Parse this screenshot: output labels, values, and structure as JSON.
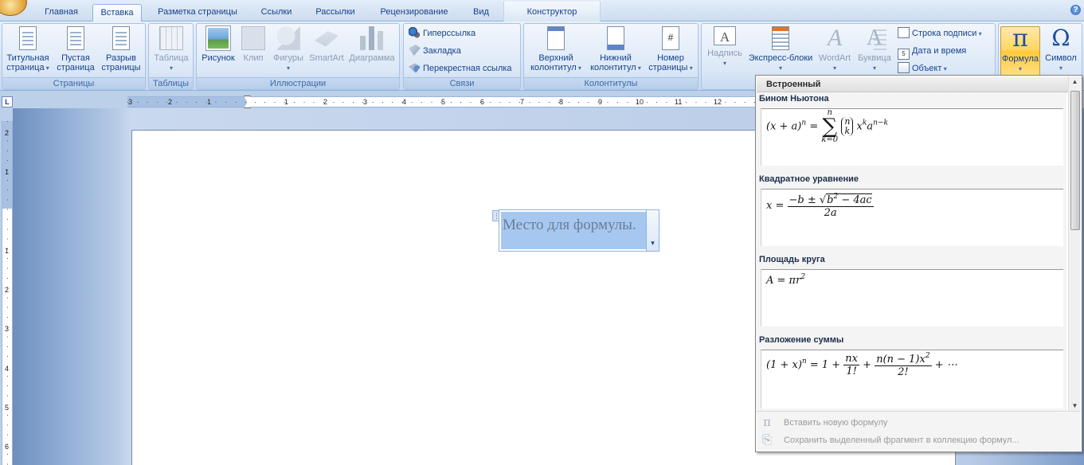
{
  "tabs": [
    {
      "label": "Главная",
      "active": false
    },
    {
      "label": "Вставка",
      "active": true
    },
    {
      "label": "Разметка страницы",
      "active": false
    },
    {
      "label": "Ссылки",
      "active": false
    },
    {
      "label": "Рассылки",
      "active": false
    },
    {
      "label": "Рецензирование",
      "active": false
    },
    {
      "label": "Вид",
      "active": false
    },
    {
      "label": "Конструктор",
      "active": false,
      "contextual": true
    }
  ],
  "help": "?",
  "groups": {
    "pages": {
      "label": "Страницы",
      "cover_l1": "Титульная",
      "cover_l2": "страница",
      "blank_l1": "Пустая",
      "blank_l2": "страница",
      "break_l1": "Разрыв",
      "break_l2": "страницы"
    },
    "tables": {
      "label": "Таблицы",
      "table": "Таблица"
    },
    "illustrations": {
      "label": "Иллюстрации",
      "picture": "Рисунок",
      "clip": "Клип",
      "shapes": "Фигуры",
      "smartart": "SmartArt",
      "chart": "Диаграмма"
    },
    "links": {
      "label": "Связи",
      "hyperlink": "Гиперссылка",
      "bookmark": "Закладка",
      "crossref": "Перекрестная ссылка"
    },
    "headers": {
      "label": "Колонтитулы",
      "header_l1": "Верхний",
      "header_l2": "колонтитул",
      "footer_l1": "Нижний",
      "footer_l2": "колонтитул",
      "pagenum_l1": "Номер",
      "pagenum_l2": "страницы"
    },
    "text": {
      "textbox": "Надпись",
      "quickparts": "Экспресс-блоки",
      "wordart": "WordArt",
      "dropcap": "Буквица",
      "signature": "Строка подписи",
      "datetime": "Дата и время",
      "object": "Объект"
    },
    "symbols": {
      "equation": "Формула",
      "symbol": "Символ"
    }
  },
  "ruler": {
    "corner": "L",
    "h_numbers": [
      "3",
      "2",
      "1",
      "1",
      "2",
      "3",
      "4",
      "5",
      "6",
      "7",
      "8",
      "9",
      "10",
      "11",
      "12"
    ],
    "v_numbers": [
      "2",
      "1",
      "1",
      "2",
      "3",
      "4",
      "5",
      "6"
    ]
  },
  "document": {
    "placeholder": "Место для формулы."
  },
  "gallery": {
    "header": "Встроенный",
    "items": [
      {
        "title": "Бином Ньютона"
      },
      {
        "title": "Квадратное уравнение"
      },
      {
        "title": "Площадь круга"
      },
      {
        "title": "Разложение суммы"
      }
    ],
    "footer": {
      "insert_new": "Вставить новую формулу",
      "save_selection": "Сохранить выделенный фрагмент в коллекцию формул..."
    }
  }
}
